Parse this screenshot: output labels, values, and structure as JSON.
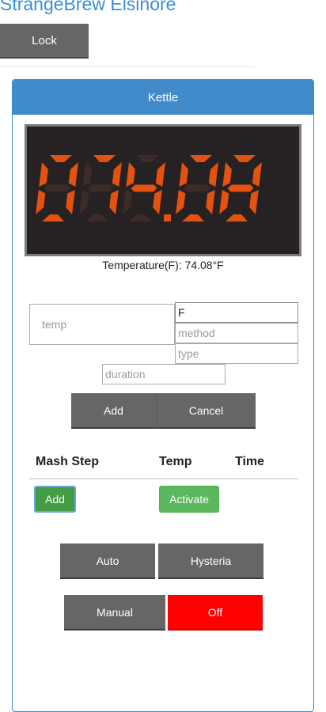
{
  "app": {
    "title": "StrangeBrew Elsinore"
  },
  "toolbar": {
    "lock_label": "Lock"
  },
  "kettle": {
    "heading": "Kettle",
    "display": {
      "digits": "074.08",
      "color_on": "#e4520f",
      "color_off": "#3c2b28",
      "bg": "#262122"
    },
    "temperature_text": "Temperature(F): 74.08°F",
    "form": {
      "temp_placeholder": "temp",
      "unit_value": "F",
      "method_placeholder": "method",
      "type_placeholder": "type",
      "duration_placeholder": "duration",
      "add_label": "Add",
      "cancel_label": "Cancel"
    },
    "mash_table": {
      "columns": [
        "Mash Step",
        "Temp",
        "Time"
      ],
      "add_label": "Add",
      "activate_label": "Activate"
    },
    "modes": {
      "auto_label": "Auto",
      "hysteria_label": "Hysteria",
      "manual_label": "Manual",
      "off_label": "Off",
      "off_color": "#ff0000"
    }
  }
}
